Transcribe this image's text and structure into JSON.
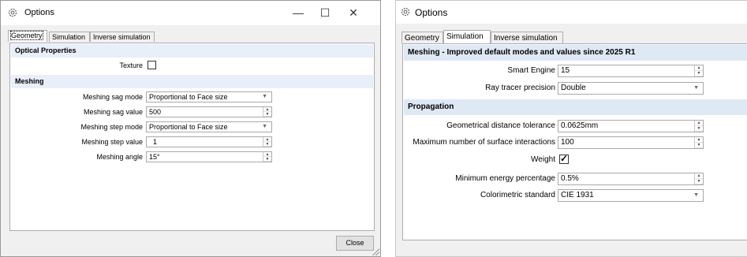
{
  "left": {
    "title": "Options",
    "controls": {
      "minimize": "—",
      "maximize": "☐",
      "close": "✕"
    },
    "tabs": [
      {
        "label": "Geometry"
      },
      {
        "label": "Simulation"
      },
      {
        "label": "Inverse simulation"
      }
    ],
    "sections": {
      "optical": "Optical Properties",
      "meshing": "Meshing"
    },
    "texture_label": "Texture",
    "fields": {
      "sag_mode": {
        "label": "Meshing sag mode",
        "value": "Proportional to Face size"
      },
      "sag_value": {
        "label": "Meshing sag value",
        "value": "500"
      },
      "step_mode": {
        "label": "Meshing step mode",
        "value": "Proportional to Face size"
      },
      "step_value": {
        "label": "Meshing step value",
        "value": "1"
      },
      "angle": {
        "label": "Meshing angle",
        "value": "15°"
      }
    },
    "close_button": "Close"
  },
  "right": {
    "title": "Options",
    "tabs": [
      {
        "label": "Geometry"
      },
      {
        "label": "Simulation"
      },
      {
        "label": "Inverse simulation"
      }
    ],
    "sections": {
      "meshing": "Meshing - Improved default modes and values since 2025 R1",
      "propagation": "Propagation"
    },
    "fields": {
      "smart_engine": {
        "label": "Smart Engine",
        "value": "15"
      },
      "ray_precision": {
        "label": "Ray tracer precision",
        "value": "Double"
      },
      "geo_tolerance": {
        "label": "Geometrical distance tolerance",
        "value": "0.0625mm"
      },
      "max_interactions": {
        "label": "Maximum number of surface interactions",
        "value": "100"
      },
      "weight": {
        "label": "Weight",
        "checked": true
      },
      "min_energy": {
        "label": "Minimum energy percentage",
        "value": "0.5%"
      },
      "colorimetric": {
        "label": "Colorimetric standard",
        "value": "CIE 1931"
      }
    }
  }
}
